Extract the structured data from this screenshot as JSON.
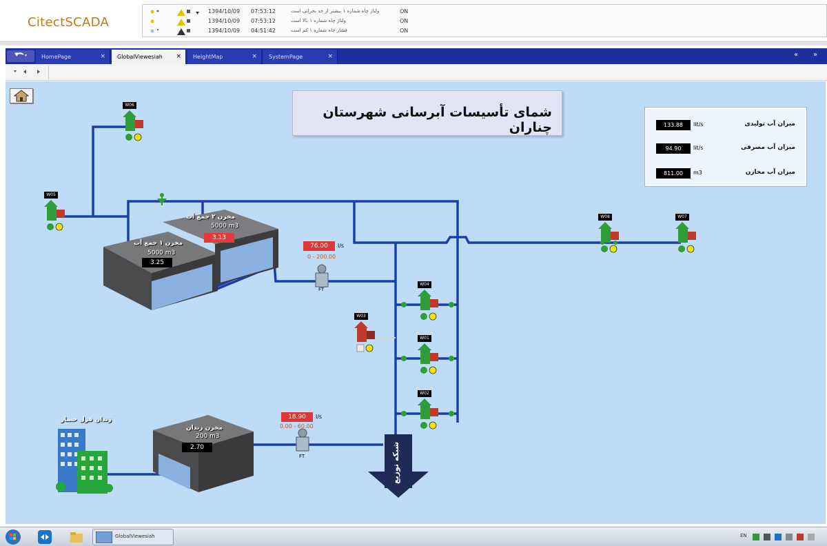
{
  "header": {
    "logo": "CitectSCADA"
  },
  "alarms": [
    {
      "date": "1394/10/09",
      "time": "07:53:12",
      "message": "ولتاژ چاه شماره ۱ بیشتر از حد بحرانی است",
      "state": "ON"
    },
    {
      "date": "1394/10/09",
      "time": "07:53:12",
      "message": "ولتاژ چاه شماره ۱ بالا است",
      "state": "ON"
    },
    {
      "date": "1394/10/09",
      "time": "04:51:42",
      "message": "فشار چاه شماره ۱ کم است",
      "state": "ON"
    }
  ],
  "tabs": [
    {
      "label": "HomePage",
      "close": "×"
    },
    {
      "label": "GlobalViewesiah",
      "close": "×"
    },
    {
      "label": "HeightMap",
      "close": "×"
    },
    {
      "label": "SystemPage",
      "close": "×"
    }
  ],
  "tab_nav": {
    "left": "«",
    "right": "»"
  },
  "title": "شمای تأسیسات آبرسانی شهرستان چناران",
  "stats": [
    {
      "label": "میزان آب تولیدی",
      "value": "133.88",
      "unit": "lit/s"
    },
    {
      "label": "میزان آب مصرفی",
      "value": "94.90",
      "unit": "lit/s"
    },
    {
      "label": "میزان آب مخازن",
      "value": "811.00",
      "unit": "m3"
    }
  ],
  "tanks": {
    "tank1": {
      "name": "مخزن ۱ جمع آب",
      "capacity": "5000 m3",
      "value": "3.25"
    },
    "tank2": {
      "name": "مخزن ۲ جمع آب",
      "capacity": "5000 m3",
      "value": "3.13"
    },
    "tank3": {
      "name": "مخزن زندان",
      "capacity": "200 m3",
      "value": "2.70"
    }
  },
  "flow_meters": {
    "fm1": {
      "value": "76.00",
      "unit": "l/s",
      "range": "0  -  200.00",
      "label": "FT"
    },
    "fm2": {
      "value": "18.90",
      "unit": "l/s",
      "range": "0.00  -  60.00",
      "label": "FT"
    }
  },
  "wells": {
    "w06": "W06",
    "w05": "W05",
    "w08": "W08",
    "w07": "W07",
    "w04": "W04",
    "w03": "W03",
    "w01": "W01",
    "w02": "W02"
  },
  "building_label": "زندان قزل حصار",
  "distribution_label": "شبکه توزیع",
  "taskbar": {
    "window_label": "GlobalViewesiah",
    "language": "EN"
  },
  "colors": {
    "pipe": "#1b3fa8",
    "background": "#bfdcf6",
    "tabbar": "#1d2f9f",
    "well_green": "#2f9e3a",
    "alarm_red": "#e03535"
  }
}
